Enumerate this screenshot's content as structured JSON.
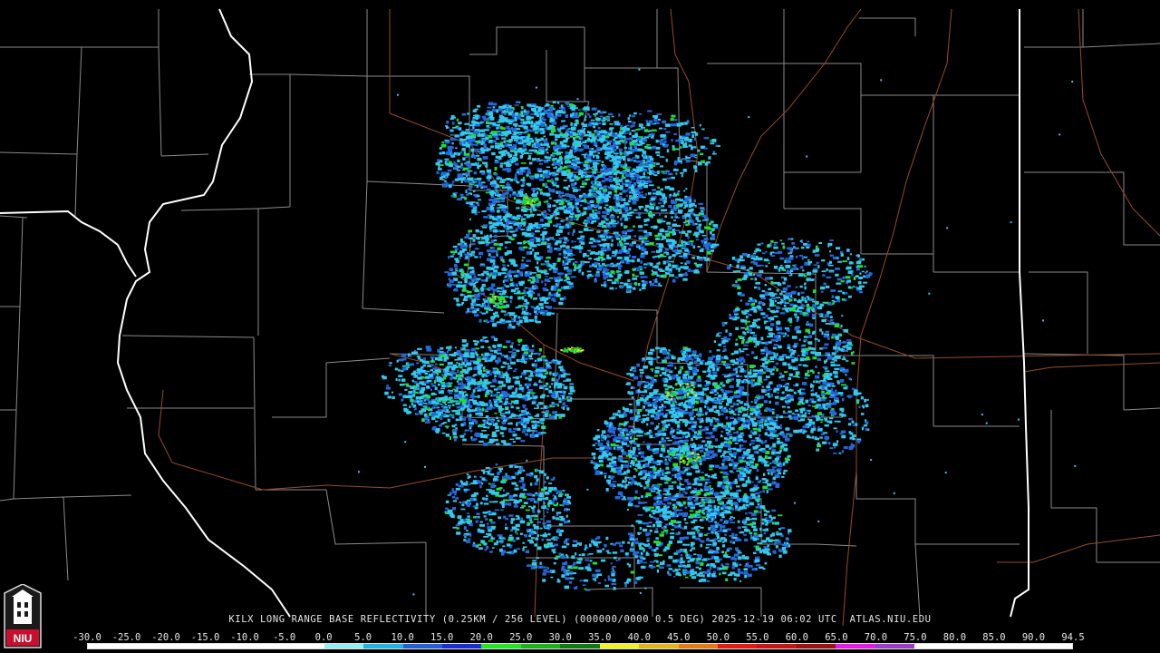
{
  "caption": "KILX LONG RANGE BASE REFLECTIVITY (0.25KM / 256 LEVEL) (000000/0000 0.5 DEG) 2025-12-19 06:02 UTC  ATLAS.NIU.EDU",
  "logo_text": "NIU",
  "scale": {
    "labels": [
      "-30.0",
      "-25.0",
      "-20.0",
      "-15.0",
      "-10.0",
      "-5.0",
      "0.0",
      "5.0",
      "10.0",
      "15.0",
      "20.0",
      "25.0",
      "30.0",
      "35.0",
      "40.0",
      "45.0",
      "50.0",
      "55.0",
      "60.0",
      "65.0",
      "70.0",
      "75.0",
      "80.0",
      "85.0",
      "90.0",
      "94.5"
    ],
    "colors": [
      "#ffffff",
      "#ffffff",
      "#ffffff",
      "#ffffff",
      "#ffffff",
      "#ffffff",
      "#8ef0f0",
      "#1eb4e6",
      "#2260d8",
      "#1a2cd8",
      "#22e622",
      "#19b419",
      "#0f7a0f",
      "#f0f022",
      "#e6b419",
      "#e67a10",
      "#e61a10",
      "#c81414",
      "#a01010",
      "#e619e6",
      "#9a3cc8",
      "#ffffff",
      "#ffffff",
      "#ffffff",
      "#ffffff"
    ]
  },
  "colors": {
    "background": "#000000",
    "county_lines": "#8a8a8a",
    "state_lines": "#ffffff",
    "highways": "#9a4a28",
    "echo_light": "#33c8ee",
    "echo_mid": "#2468dc",
    "echo_strong": "#22dd33",
    "echo_peak": "#f0e020"
  }
}
